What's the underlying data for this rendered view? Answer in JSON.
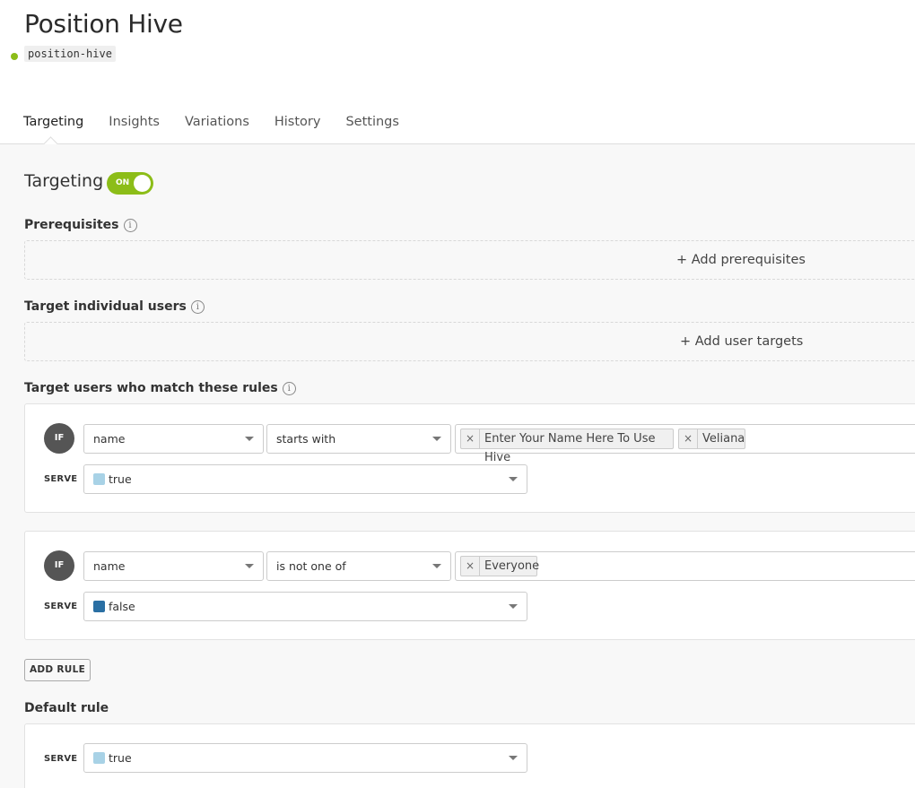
{
  "flag": {
    "title": "Position Hive",
    "key": "position-hive",
    "status_color": "#8cbd18"
  },
  "tabs": [
    {
      "label": "Targeting",
      "active": true
    },
    {
      "label": "Insights",
      "active": false
    },
    {
      "label": "Variations",
      "active": false
    },
    {
      "label": "History",
      "active": false
    },
    {
      "label": "Settings",
      "active": false
    }
  ],
  "targeting": {
    "title": "Targeting",
    "toggle_label": "ON",
    "toggle_color": "#8cbd18"
  },
  "prerequisites": {
    "label": "Prerequisites",
    "add_label": "+ Add prerequisites"
  },
  "individual": {
    "label": "Target individual users",
    "add_label": "+ Add user targets"
  },
  "rules_section": {
    "label": "Target users who match these rules"
  },
  "info_icon": "info-icon",
  "rules": [
    {
      "if_label": "IF",
      "attribute": "name",
      "operator": "starts with",
      "values": [
        "Enter Your Name Here To Use Hive",
        "Veliana"
      ],
      "serve_label": "SERVE",
      "serve_value": "true",
      "serve_color": "#a8d2e6"
    },
    {
      "if_label": "IF",
      "attribute": "name",
      "operator": "is not one of",
      "values": [
        "Everyone"
      ],
      "serve_label": "SERVE",
      "serve_value": "false",
      "serve_color": "#2a6fa3"
    }
  ],
  "chip_remove": "×",
  "add_rule_label": "ADD RULE",
  "default_rule": {
    "label": "Default rule",
    "serve_label": "SERVE",
    "serve_value": "true",
    "serve_color": "#a8d2e6"
  }
}
